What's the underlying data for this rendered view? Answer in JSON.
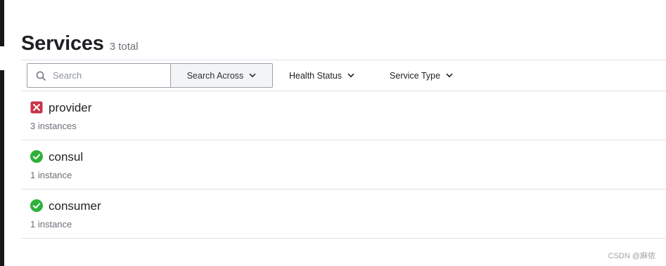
{
  "page": {
    "title": "Services",
    "total": "3 total"
  },
  "toolbar": {
    "search_placeholder": "Search",
    "search_across_label": "Search Across",
    "health_status_label": "Health Status",
    "service_type_label": "Service Type"
  },
  "services": [
    {
      "name": "provider",
      "instances": "3 instances",
      "status": "failing",
      "status_icon": "x-square-icon",
      "status_color": "#c73445"
    },
    {
      "name": "consul",
      "instances": "1 instance",
      "status": "passing",
      "status_icon": "check-circle-icon",
      "status_color": "#2eb039"
    },
    {
      "name": "consumer",
      "instances": "1 instance",
      "status": "passing",
      "status_icon": "check-circle-icon",
      "status_color": "#2eb039"
    }
  ],
  "watermark": "CSDN @麻侬"
}
